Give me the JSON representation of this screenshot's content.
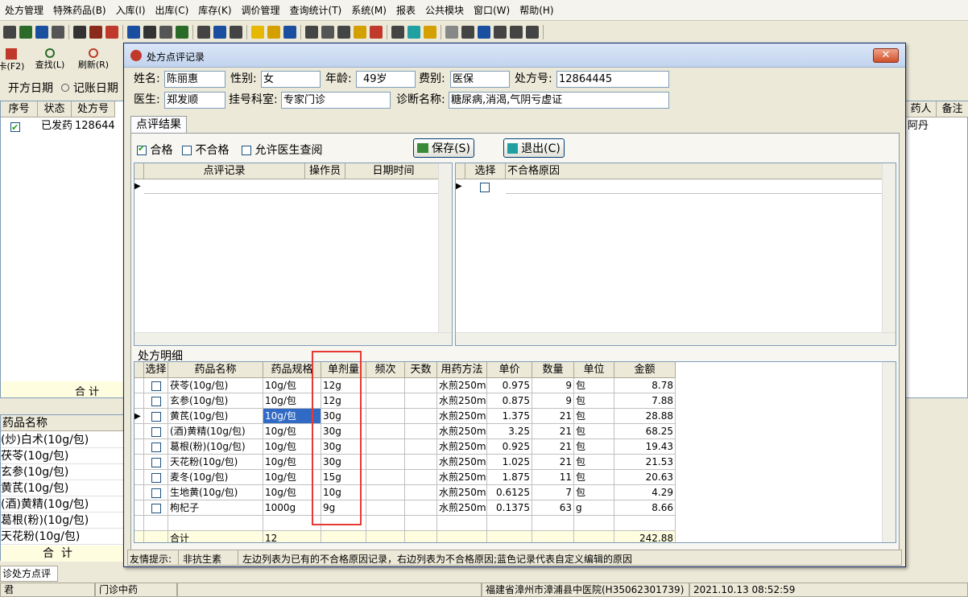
{
  "menu": [
    "处方管理",
    "特殊药品(B)",
    "入库(I)",
    "出库(C)",
    "库存(K)",
    "调价管理",
    "查询统计(T)",
    "系统(M)",
    "报表",
    "公共模块",
    "窗口(W)",
    "帮助(H)"
  ],
  "bg": {
    "buttons": [
      "卡(F2)",
      "查找(L)",
      "刷新(R)"
    ],
    "radio_open_date": "开方日期",
    "radio_account_date": "记账日期",
    "headers": [
      "序号",
      "状态",
      "处方号",
      "药人",
      "备注"
    ],
    "row": {
      "status": "已发药",
      "rx_no": "128644",
      "first": "1",
      "pharmacist": "阿丹"
    },
    "total_label": "合 计",
    "drug_header": "药品名称",
    "drugs": [
      "(炒)白术(10g/包)",
      "茯苓(10g/包)",
      "玄参(10g/包)",
      "黄芪(10g/包)",
      "(酒)黄精(10g/包)",
      "葛根(粉)(10g/包)",
      "天花粉(10g/包)"
    ],
    "drug_total": "合  计",
    "tab": "诊处方点评",
    "status_left": "君",
    "status_dept": "门诊中药",
    "status_hospital": "福建省漳州市漳浦县中医院(H35062301739)",
    "status_time": "2021.10.13 08:52:59"
  },
  "dialog": {
    "title": "处方点评记录",
    "name_label": "姓名:",
    "name": "陈丽惠",
    "sex_label": "性别:",
    "sex": "女",
    "age_label": "年龄:",
    "age": "49岁",
    "fee_label": "费别:",
    "fee": "医保",
    "rx_label": "处方号:",
    "rx_no": "12864445",
    "doctor_label": "医生:",
    "doctor": "郑发顺",
    "dept_label": "挂号科室:",
    "dept": "专家门诊",
    "diag_label": "诊断名称:",
    "diag": "糖尿病,消渴,气阴亏虚证",
    "tab": "点评结果",
    "chk_pass": "合格",
    "chk_fail": "不合格",
    "chk_doctor": "允许医生查阅",
    "save": "保存(S)",
    "exit": "退出(C)",
    "review_headers": [
      "点评记录",
      "操作员",
      "日期时间"
    ],
    "reason_headers": [
      "选择",
      "不合格原因"
    ],
    "detail_title": "处方明细",
    "detail_headers": [
      "选择",
      "药品名称",
      "药品规格",
      "单剂量",
      "频次",
      "天数",
      "用药方法",
      "单价",
      "数量",
      "单位",
      "金额"
    ],
    "detail_rows": [
      {
        "name": "茯苓(10g/包)",
        "spec": "10g/包",
        "dose": "12g",
        "method": "水煎250m",
        "price": "0.975",
        "qty": "9",
        "unit": "包",
        "amount": "8.78"
      },
      {
        "name": "玄参(10g/包)",
        "spec": "10g/包",
        "dose": "12g",
        "method": "水煎250m",
        "price": "0.875",
        "qty": "9",
        "unit": "包",
        "amount": "7.88"
      },
      {
        "name": "黄芪(10g/包)",
        "spec": "10g/包",
        "dose": "30g",
        "method": "水煎250m",
        "price": "1.375",
        "qty": "21",
        "unit": "包",
        "amount": "28.88"
      },
      {
        "name": "(酒)黄精(10g/包)",
        "spec": "10g/包",
        "dose": "30g",
        "method": "水煎250m",
        "price": "3.25",
        "qty": "21",
        "unit": "包",
        "amount": "68.25"
      },
      {
        "name": "葛根(粉)(10g/包)",
        "spec": "10g/包",
        "dose": "30g",
        "method": "水煎250m",
        "price": "0.925",
        "qty": "21",
        "unit": "包",
        "amount": "19.43"
      },
      {
        "name": "天花粉(10g/包)",
        "spec": "10g/包",
        "dose": "30g",
        "method": "水煎250m",
        "price": "1.025",
        "qty": "21",
        "unit": "包",
        "amount": "21.53"
      },
      {
        "name": "麦冬(10g/包)",
        "spec": "10g/包",
        "dose": "15g",
        "method": "水煎250m",
        "price": "1.875",
        "qty": "11",
        "unit": "包",
        "amount": "20.63"
      },
      {
        "name": "生地黄(10g/包)",
        "spec": "10g/包",
        "dose": "10g",
        "method": "水煎250m",
        "price": "0.6125",
        "qty": "7",
        "unit": "包",
        "amount": "4.29"
      },
      {
        "name": "枸杞子",
        "spec": "1000g",
        "dose": "9g",
        "method": "水煎250m",
        "price": "0.1375",
        "qty": "63",
        "unit": "g",
        "amount": "8.66"
      }
    ],
    "total_label": "合计",
    "total_count": "12",
    "total_amount": "242.88",
    "hint_label": "友情提示:",
    "hint_type": "非抗生素",
    "hint_text": "左边列表为已有的不合格原因记录，右边列表为不合格原因;蓝色记录代表自定义编辑的原因"
  },
  "colors": {
    "highlight": "#316ac5",
    "total_row": "#fffde0",
    "annotation": "#e53935"
  }
}
